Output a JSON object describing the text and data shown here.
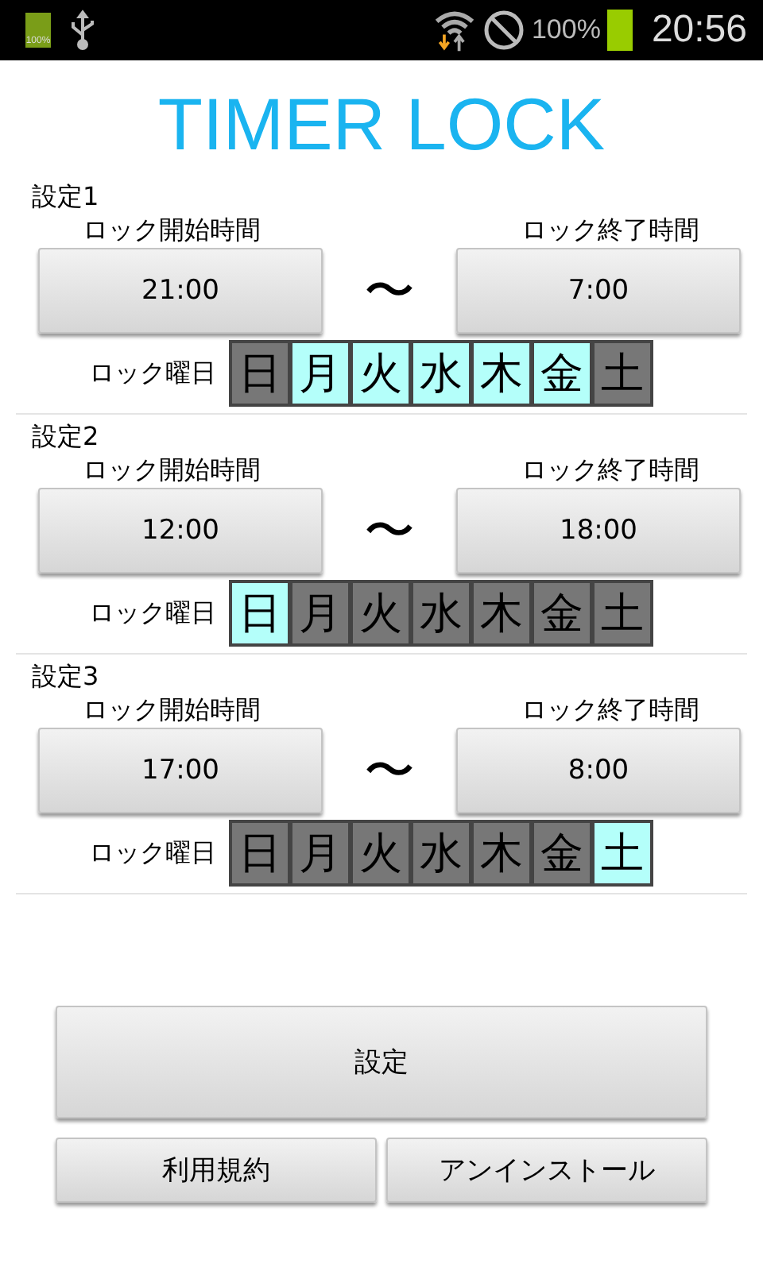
{
  "status_bar": {
    "notification_battery_label": "100%",
    "battery_percent": "100%",
    "time": "20:56"
  },
  "title": "TIMER LOCK",
  "settings": [
    {
      "label": "設定1",
      "start_label": "ロック開始時間",
      "end_label": "ロック終了時間",
      "start_time": "21:00",
      "separator": "〜",
      "end_time": "7:00",
      "days_label": "ロック曜日",
      "days": [
        {
          "label": "日",
          "selected": false
        },
        {
          "label": "月",
          "selected": true
        },
        {
          "label": "火",
          "selected": true
        },
        {
          "label": "水",
          "selected": true
        },
        {
          "label": "木",
          "selected": true
        },
        {
          "label": "金",
          "selected": true
        },
        {
          "label": "土",
          "selected": false
        }
      ]
    },
    {
      "label": "設定2",
      "start_label": "ロック開始時間",
      "end_label": "ロック終了時間",
      "start_time": "12:00",
      "separator": "〜",
      "end_time": "18:00",
      "days_label": "ロック曜日",
      "days": [
        {
          "label": "日",
          "selected": true
        },
        {
          "label": "月",
          "selected": false
        },
        {
          "label": "火",
          "selected": false
        },
        {
          "label": "水",
          "selected": false
        },
        {
          "label": "木",
          "selected": false
        },
        {
          "label": "金",
          "selected": false
        },
        {
          "label": "土",
          "selected": false
        }
      ]
    },
    {
      "label": "設定3",
      "start_label": "ロック開始時間",
      "end_label": "ロック終了時間",
      "start_time": "17:00",
      "separator": "〜",
      "end_time": "8:00",
      "days_label": "ロック曜日",
      "days": [
        {
          "label": "日",
          "selected": false
        },
        {
          "label": "月",
          "selected": false
        },
        {
          "label": "火",
          "selected": false
        },
        {
          "label": "水",
          "selected": false
        },
        {
          "label": "木",
          "selected": false
        },
        {
          "label": "金",
          "selected": false
        },
        {
          "label": "土",
          "selected": true
        }
      ]
    }
  ],
  "save_button": "設定",
  "buttons": [
    "利用規約",
    "アンインストール"
  ]
}
